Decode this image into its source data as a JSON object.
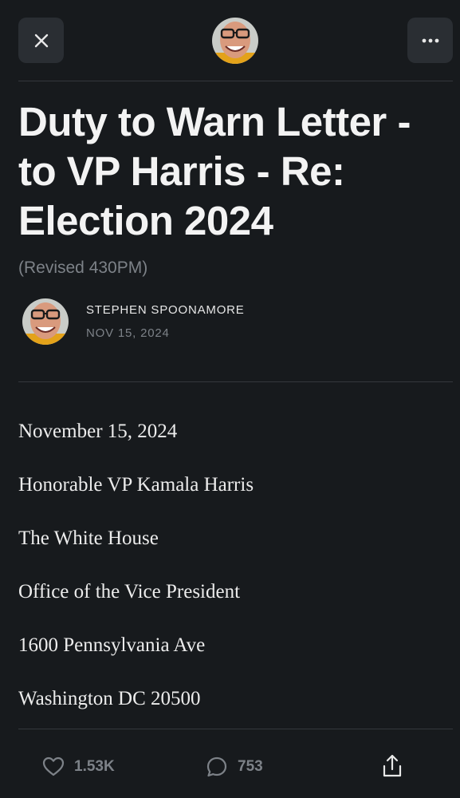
{
  "header": {
    "close_icon": "close-icon",
    "more_icon": "more-horizontal-icon"
  },
  "post": {
    "title": "Duty to Warn Letter - to VP Harris - Re: Election 2024",
    "subtitle": "(Revised 430PM)",
    "author": "STEPHEN SPOONAMORE",
    "date": "NOV 15, 2024"
  },
  "body": {
    "lines": [
      "November 15, 2024",
      "Honorable VP Kamala Harris",
      "The White House",
      "Office of the Vice President",
      "1600 Pennsylvania Ave",
      "Washington DC 20500"
    ]
  },
  "footer": {
    "likes": "1.53K",
    "comments": "753",
    "like_icon": "heart-icon",
    "comment_icon": "comment-icon",
    "share_icon": "share-icon"
  },
  "colors": {
    "background": "#171a1d",
    "button_bg": "#2a2e33",
    "muted_text": "#7d8288",
    "divider": "#34383d"
  }
}
